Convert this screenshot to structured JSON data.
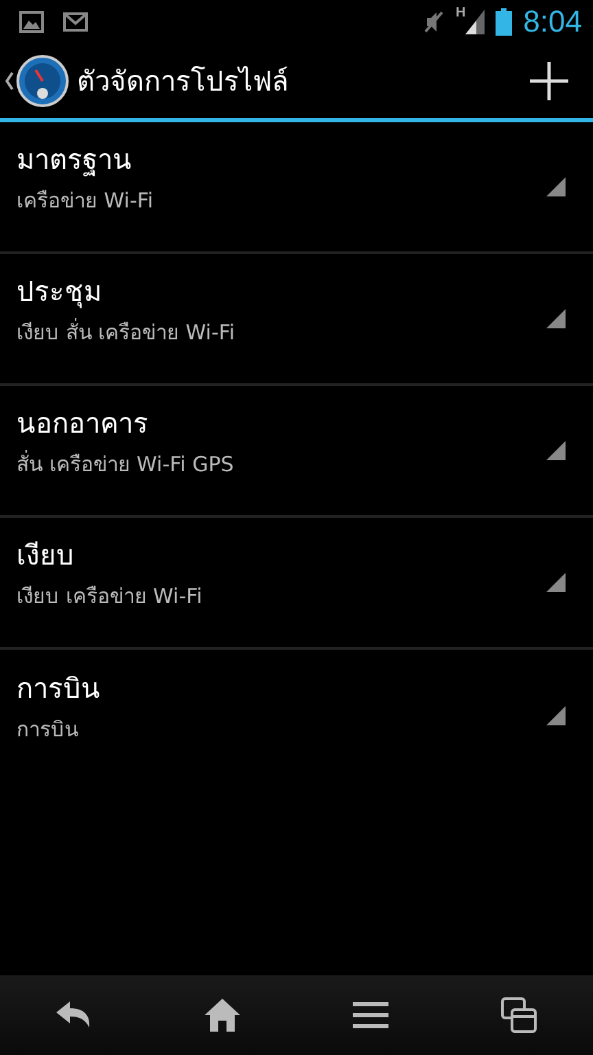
{
  "status_bar": {
    "time": "8:04",
    "network": "H"
  },
  "action_bar": {
    "title": "ตัวจัดการโปรไฟล์"
  },
  "profiles": [
    {
      "name": "มาตรฐาน",
      "summary": "เครือข่าย Wi-Fi"
    },
    {
      "name": "ประชุม",
      "summary": "เงียบ สั่น เครือข่าย Wi-Fi"
    },
    {
      "name": "นอกอาคาร",
      "summary": "สั่น เครือข่าย Wi-Fi GPS"
    },
    {
      "name": "เงียบ",
      "summary": "เงียบ เครือข่าย Wi-Fi"
    },
    {
      "name": "การบิน",
      "summary": "การบิน"
    }
  ]
}
